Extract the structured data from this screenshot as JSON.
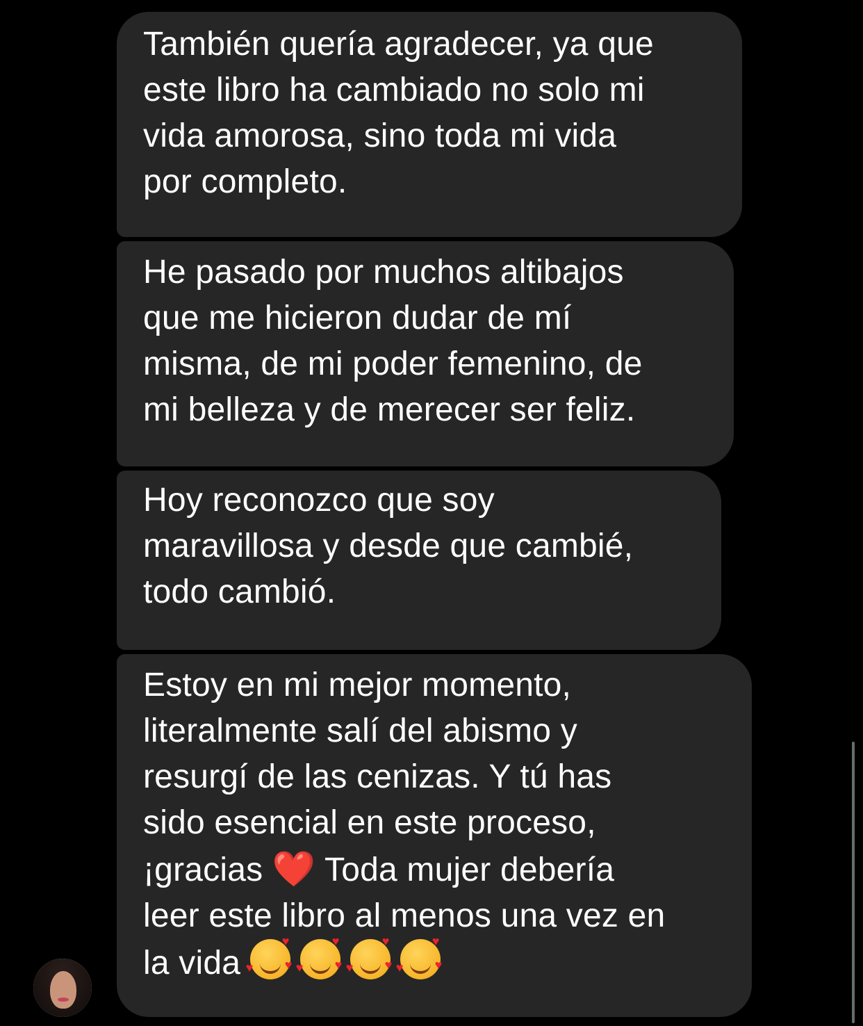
{
  "messages": [
    {
      "text": "También quería agradecer, ya que\neste libro ha cambiado no solo mi\nvida amorosa, sino toda mi vida\npor completo."
    },
    {
      "text": "He pasado por muchos altibajos\nque me hicieron dudar de mí\nmisma, de mi poder femenino, de\nmi belleza y de merecer ser feliz."
    },
    {
      "text": "Hoy reconozco que soy\nmaravillosa y desde que cambié,\ntodo cambió."
    },
    {
      "text_before_heart": "Estoy en mi mejor momento,\nliteralmente salí del abismo y\nresurgí de las cenizas. Y tú has\nsido esencial en este proceso,\n¡gracias ",
      "heart": "❤️",
      "text_after_heart": " Toda mujer debería\nleer este libro al menos una vez en\nla vida ",
      "trailing_emoji": [
        "smiling-face-with-hearts",
        "smiling-face-with-hearts",
        "smiling-face-with-hearts",
        "smiling-face-with-hearts"
      ]
    }
  ],
  "colors": {
    "background": "#000000",
    "bubble": "#262626",
    "text": "#ffffff"
  },
  "sender": {
    "avatar": "profile-photo"
  }
}
